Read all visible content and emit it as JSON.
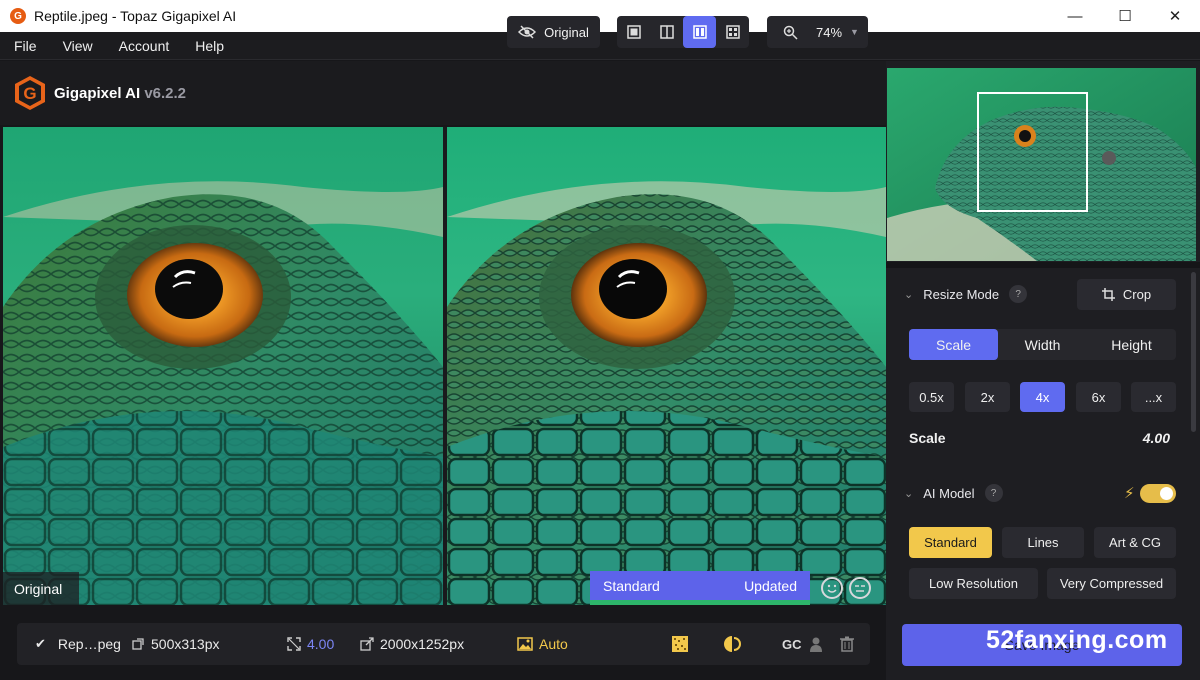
{
  "window": {
    "title": "Reptile.jpeg - Topaz Gigapixel AI",
    "app_icon_letter": "G",
    "minimize": "—",
    "maximize": "☐",
    "close": "✕"
  },
  "menu": [
    "File",
    "View",
    "Account",
    "Help"
  ],
  "toolbar": {
    "brand": "Gigapixel AI",
    "version": "v6.2.2",
    "original_button": "Original",
    "zoom": "74%",
    "view_modes": [
      "single-view",
      "split-view",
      "side-by-side-view",
      "quad-view"
    ],
    "active_view": "side-by-side-view"
  },
  "viewer": {
    "left_label": "Original",
    "model_label": "Standard",
    "status_label": "Updated"
  },
  "status": {
    "file": "Rep…peg",
    "input_size": "500x313px",
    "scale": "4.00",
    "output_size": "2000x1252px",
    "auto_label": "Auto",
    "gc_label": "GC"
  },
  "panel": {
    "resize_mode": {
      "title": "Resize Mode",
      "help": "?",
      "crop": "Crop",
      "tabs": [
        "Scale",
        "Width",
        "Height"
      ],
      "active_tab": "Scale",
      "presets": [
        "0.5x",
        "2x",
        "4x",
        "6x",
        "...x"
      ],
      "active_preset": "4x",
      "scale_label": "Scale",
      "scale_value": "4.00"
    },
    "ai_model": {
      "title": "AI Model",
      "help": "?",
      "models_row1": [
        "Standard",
        "Lines",
        "Art & CG"
      ],
      "models_row2": [
        "Low Resolution",
        "Very Compressed"
      ],
      "active_model": "Standard",
      "toggle_on": true
    },
    "save_button": "Save Image"
  },
  "watermark": "52fanxing.com",
  "colors": {
    "accent": "#5f6bf0",
    "highlight": "#f2c84b",
    "brand_orange": "#e65c12",
    "success": "#2db56a"
  }
}
